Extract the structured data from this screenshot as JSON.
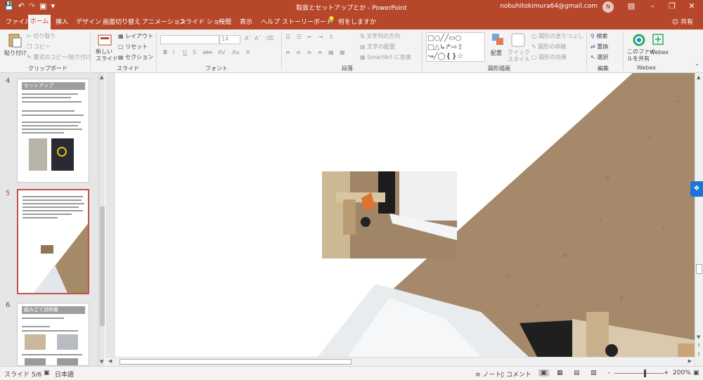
{
  "window": {
    "title": "取扱とセットアップとか - PowerPoint",
    "account": "nobuhitokimura64@gmail.com",
    "avatar_letter": "N"
  },
  "tabs": [
    "ファイル",
    "ホーム",
    "挿入",
    "デザイン",
    "画面切り替え",
    "アニメーション",
    "スライド ショー",
    "校閲",
    "表示",
    "ヘルプ",
    "ストーリーボード",
    "何をしますか"
  ],
  "share_label": "共有",
  "ribbon": {
    "clipboard": {
      "label": "クリップボード",
      "paste": "貼り付け",
      "cut": "切り取り",
      "copy": "コピー",
      "format_painter": "書式のコピー/貼り付け"
    },
    "slides": {
      "label": "スライド",
      "new_slide": "新しい\nスライド",
      "layout": "レイアウト",
      "reset": "リセット",
      "section": "セクション"
    },
    "font": {
      "label": "フォント",
      "font_size": "14"
    },
    "paragraph": {
      "label": "段落",
      "text_direction": "文字列の方向",
      "align_text": "文字の配置",
      "smartart": "SmartArt に変換"
    },
    "drawing": {
      "label": "図形描画",
      "arrange": "配置",
      "quick_styles": "クイック\nスタイル",
      "shape_fill": "図形の塗りつぶし",
      "shape_outline": "図形の枠線",
      "shape_effects": "図形の効果"
    },
    "editing": {
      "label": "編集",
      "find": "検索",
      "replace": "置換",
      "select": "選択"
    },
    "webex": {
      "label": "Webex",
      "share_file": "このファイ\nルを共有",
      "webex": "Webex"
    }
  },
  "thumbnails": [
    {
      "number": "4",
      "title": "セットアップ"
    },
    {
      "number": "5",
      "title": ""
    },
    {
      "number": "6",
      "title": "組み立て説明書"
    }
  ],
  "status": {
    "slide_position": "スライド 5/6",
    "language": "日本語",
    "notes": "ノート",
    "comments": "コメント",
    "zoom": "200%"
  },
  "colors": {
    "accent": "#b7472a",
    "ribbon_bg": "#f3f3f3",
    "pane_bg": "#e6e6e6",
    "selection": "#c0504d"
  }
}
